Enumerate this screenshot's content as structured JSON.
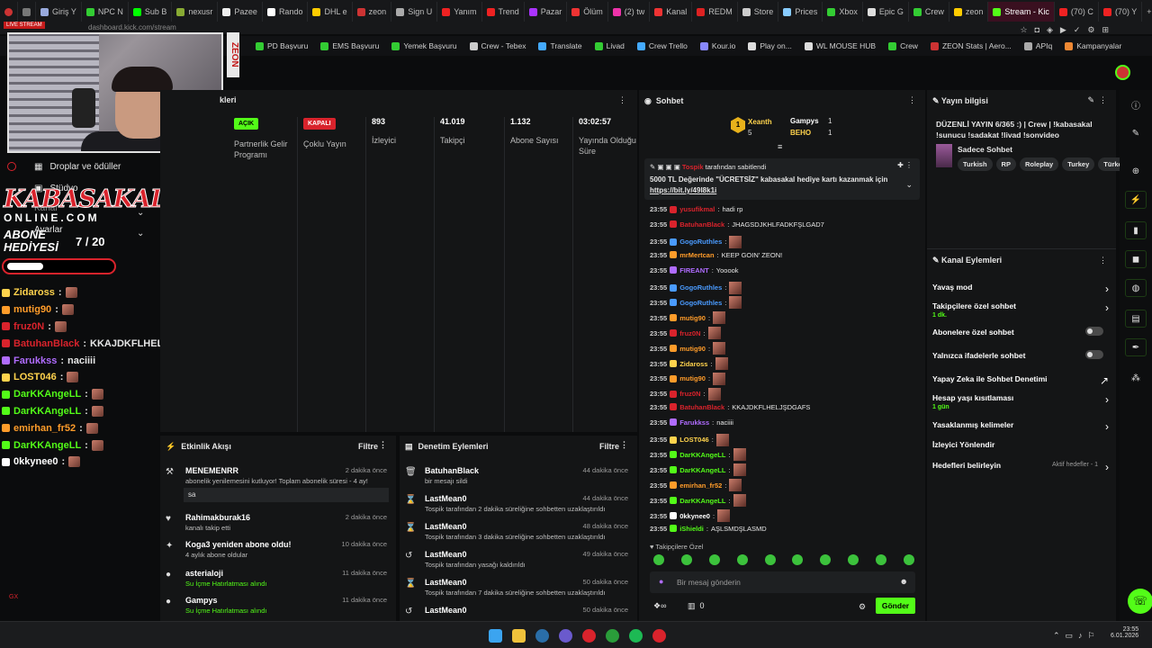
{
  "colors": {
    "accent": "#53fc18",
    "danger": "#d9232c",
    "panel": "#141516"
  },
  "browser": {
    "tabs": [
      {
        "label": "Giriş Y",
        "fav": "#9ad"
      },
      {
        "label": "NPC N",
        "fav": "#3c3"
      },
      {
        "label": "Sub B",
        "fav": "#0f0"
      },
      {
        "label": "nexusr",
        "fav": "#8a3"
      },
      {
        "label": "Pazee",
        "fav": "#eee"
      },
      {
        "label": "Rando",
        "fav": "#fff"
      },
      {
        "label": "DHL e",
        "fav": "#fc0"
      },
      {
        "label": "zeon",
        "fav": "#c33"
      },
      {
        "label": "Sign U",
        "fav": "#aaa"
      },
      {
        "label": "Yanım",
        "fav": "#e22"
      },
      {
        "label": "Trend",
        "fav": "#e22"
      },
      {
        "label": "Pazar",
        "fav": "#a3f"
      },
      {
        "label": "Ölüm",
        "fav": "#e33"
      },
      {
        "label": "(2) tw",
        "fav": "#e3a"
      },
      {
        "label": "Kanal",
        "fav": "#e33"
      },
      {
        "label": "REDM",
        "fav": "#d22"
      },
      {
        "label": "Store",
        "fav": "#ccc"
      },
      {
        "label": "Prices",
        "fav": "#8cf"
      },
      {
        "label": "Xbox",
        "fav": "#3c3"
      },
      {
        "label": "Epic G",
        "fav": "#ddd"
      },
      {
        "label": "Crew",
        "fav": "#3c3"
      },
      {
        "label": "zeon",
        "fav": "#fc0"
      },
      {
        "label": "Stream - Kic",
        "fav": "#53fc18",
        "active": true
      },
      {
        "label": "(70) C",
        "fav": "#e22"
      },
      {
        "label": "(70) Y",
        "fav": "#e22"
      }
    ],
    "address": "dashboard.kick.com/stream",
    "bookmarks": [
      {
        "label": "PD Başvuru",
        "color": "#3c3"
      },
      {
        "label": "EMS Başvuru",
        "color": "#3c3"
      },
      {
        "label": "Yemek Başvuru",
        "color": "#3c3"
      },
      {
        "label": "Crew - Tebex",
        "color": "#ccc"
      },
      {
        "label": "Translate",
        "color": "#4af"
      },
      {
        "label": "Livad",
        "color": "#3c3"
      },
      {
        "label": "Crew Trello",
        "color": "#4af"
      },
      {
        "label": "Kour.io",
        "color": "#88f"
      },
      {
        "label": "Play on...",
        "color": "#ddd"
      },
      {
        "label": "WL MOUSE HUB",
        "color": "#ddd"
      },
      {
        "label": "Crew",
        "color": "#3c3"
      },
      {
        "label": "ZEON Stats | Aero...",
        "color": "#c33"
      },
      {
        "label": "APIq",
        "color": "#aaa"
      },
      {
        "label": "Kampanyalar",
        "color": "#e83"
      }
    ]
  },
  "webcam": {
    "live_badge": "LIVE STREAM",
    "side_banner": "ZEON"
  },
  "left_menu": {
    "drops": "Droplar ve ödüller",
    "studio": "Stüdyo",
    "kanal": "Kanal",
    "settings": "Ayarlar"
  },
  "overlay": {
    "brand_line1": "KABASAKAL",
    "brand_line2": "ONLINE.COM",
    "sub_goal_line1": "ABONE",
    "sub_goal_line2": "HEDİYESİ",
    "sub_goal_count": "7 / 20",
    "sub_goal_progress": 0.35,
    "chat": [
      {
        "user": "Zidaross",
        "color": "#ffd34d",
        "msg": "",
        "emote": true
      },
      {
        "user": "mutig90",
        "color": "#ff9c2a",
        "msg": "",
        "emote": true
      },
      {
        "user": "fruz0N",
        "color": "#d9232c",
        "msg": "",
        "emote": true
      },
      {
        "user": "BatuhanBlack",
        "color": "#d9232c",
        "msg": "KKAJDKFLHELJŞDGAFS",
        "emote": false
      },
      {
        "user": "Farukkss",
        "color": "#b06cff",
        "msg": "naciiii",
        "emote": false
      },
      {
        "user": "LOST046",
        "color": "#ffd34d",
        "msg": "",
        "emote": true
      },
      {
        "user": "DarKKAngeLL",
        "color": "#53fc18",
        "msg": "",
        "emote": true
      },
      {
        "user": "DarKKAngeLL",
        "color": "#53fc18",
        "msg": "",
        "emote": true
      },
      {
        "user": "emirhan_fr52",
        "color": "#ff9c2a",
        "msg": "",
        "emote": true
      },
      {
        "user": "DarKKAngeLL",
        "color": "#53fc18",
        "msg": "",
        "emote": true
      },
      {
        "user": "0kkynee0",
        "color": "#ffffff",
        "msg": "",
        "emote": true
      }
    ]
  },
  "main": {
    "header": "kleri",
    "stats": [
      {
        "pill": "AÇIK",
        "pill_color": "#53fc18",
        "label": "Partnerlik Gelir Programı"
      },
      {
        "pill": "KAPALI",
        "pill_color": "#d9232c",
        "label": "Çoklu Yayın"
      },
      {
        "value": "893",
        "label": "İzleyici"
      },
      {
        "value": "41.019",
        "label": "Takipçi"
      },
      {
        "value": "1.132",
        "label": "Abone Sayısı"
      },
      {
        "value": "03:02:57",
        "label": "Yayında Olduğu Süre"
      }
    ]
  },
  "activity": {
    "title": "Etkinlik Akışı",
    "filter": "Filtre",
    "items": [
      {
        "icon": "⚒",
        "name": "MENEMENRR",
        "time": "2 dakika önce",
        "sub": "abonelik yenilemesini kutluyor! Toplam abonelik süresi - 4 ay!",
        "quote": "sa"
      },
      {
        "icon": "♥",
        "name": "Rahimakburak16",
        "time": "2 dakika önce",
        "sub": "kanalı takip etti"
      },
      {
        "icon": "✦",
        "name": "Koga3 yeniden abone oldu!",
        "time": "10 dakika önce",
        "sub": "4 aylık abone oldular"
      },
      {
        "icon": "●",
        "name": "asterialoji",
        "time": "11 dakika önce",
        "sub": "Su İçme Hatırlatması alındı",
        "hl": "Su İçme Hatırlatması"
      },
      {
        "icon": "●",
        "name": "Gampys",
        "time": "11 dakika önce",
        "sub": "Su İçme Hatırlatması alındı",
        "hl": "Su İçme Hatırlatması"
      }
    ]
  },
  "moderation": {
    "title": "Denetim Eylemleri",
    "filter": "Filtre",
    "items": [
      {
        "icon": "🗑",
        "name": "BatuhanBlack",
        "time": "44 dakika önce",
        "sub": "bir mesajı sildi"
      },
      {
        "icon": "⌛",
        "name": "LastMean0",
        "time": "44 dakika önce",
        "sub": "Tospik tarafından 2 dakika süreliğine sohbetten uzaklaştırıldı"
      },
      {
        "icon": "⌛",
        "name": "LastMean0",
        "time": "48 dakika önce",
        "sub": "Tospik tarafından 3 dakika süreliğine sohbetten uzaklaştırıldı"
      },
      {
        "icon": "↺",
        "name": "LastMean0",
        "time": "49 dakika önce",
        "sub": "Tospik tarafından yasağı kaldırıldı"
      },
      {
        "icon": "⌛",
        "name": "LastMean0",
        "time": "50 dakika önce",
        "sub": "Tospik tarafından 7 dakika süreliğine sohbetten uzaklaştırıldı"
      },
      {
        "icon": "↺",
        "name": "LastMean0",
        "time": "50 dakika önce",
        "sub": ""
      }
    ]
  },
  "chat": {
    "title": "Sohbet",
    "top_gifters": [
      {
        "name": "Xeanth",
        "count": "5",
        "rank": "1"
      },
      {
        "name": "Gampys",
        "count": "1"
      },
      {
        "name": "BEHO",
        "count": "1"
      }
    ],
    "pinned_by": "Tospik",
    "pinned_label": "tarafından sabitlendi",
    "pinned_text": "5000 TL Değerinde \"ÜCRETSİZ\" kabasakal hediye kartı kazanmak için",
    "pinned_link": "https://bit.ly/49I8k1i",
    "messages": [
      {
        "t": "23:55",
        "u": "yusufikmal",
        "c": "#d9232c",
        "m": "hadi rp"
      },
      {
        "t": "23:55",
        "u": "BatuhanBlack",
        "c": "#d9232c",
        "m": "JHAGSDJKHLFADKFŞLGAD7"
      },
      {
        "t": "23:55",
        "u": "GogoRuthles",
        "c": "#4a9bff",
        "m": "",
        "e": true
      },
      {
        "t": "23:55",
        "u": "mrMertcan",
        "c": "#ff9c2a",
        "m": "KEEP GOIN' ZEON!"
      },
      {
        "t": "23:55",
        "u": "FIREANT",
        "c": "#b06cff",
        "m": "Yooook"
      },
      {
        "t": "23:55",
        "u": "GogoRuthles",
        "c": "#4a9bff",
        "m": "",
        "e": true
      },
      {
        "t": "23:55",
        "u": "GogoRuthles",
        "c": "#4a9bff",
        "m": "",
        "e": true
      },
      {
        "t": "23:55",
        "u": "mutig90",
        "c": "#ff9c2a",
        "m": "",
        "e": true
      },
      {
        "t": "23:55",
        "u": "fruz0N",
        "c": "#d9232c",
        "m": "",
        "e": true
      },
      {
        "t": "23:55",
        "u": "mutig90",
        "c": "#ff9c2a",
        "m": "",
        "e": true
      },
      {
        "t": "23:55",
        "u": "Zidaross",
        "c": "#ffd34d",
        "m": "",
        "e": true
      },
      {
        "t": "23:55",
        "u": "mutig90",
        "c": "#ff9c2a",
        "m": "",
        "e": true
      },
      {
        "t": "23:55",
        "u": "fruz0N",
        "c": "#d9232c",
        "m": "",
        "e": true
      },
      {
        "t": "23:55",
        "u": "BatuhanBlack",
        "c": "#d9232c",
        "m": "KKAJDKFLHELJŞDGAFS"
      },
      {
        "t": "23:55",
        "u": "Farukkss",
        "c": "#b06cff",
        "m": "naciiii"
      },
      {
        "t": "23:55",
        "u": "LOST046",
        "c": "#ffd34d",
        "m": "",
        "e": true
      },
      {
        "t": "23:55",
        "u": "DarKKAngeLL",
        "c": "#53fc18",
        "m": "",
        "e": true
      },
      {
        "t": "23:55",
        "u": "DarKKAngeLL",
        "c": "#53fc18",
        "m": "",
        "e": true
      },
      {
        "t": "23:55",
        "u": "emirhan_fr52",
        "c": "#ff9c2a",
        "m": "",
        "e": true
      },
      {
        "t": "23:55",
        "u": "DarKKAngeLL",
        "c": "#53fc18",
        "m": "",
        "e": true
      },
      {
        "t": "23:55",
        "u": "0kkynee0",
        "c": "#ffffff",
        "m": "",
        "e": true
      },
      {
        "t": "23:55",
        "u": "iShieldi",
        "c": "#53fc18",
        "m": "AŞLSMDŞLASMD"
      }
    ],
    "followers_only": "Takipçilere Özel",
    "input_placeholder": "Bir mesaj gönderin",
    "count": "0",
    "send": "Gönder"
  },
  "stream_info": {
    "title": "Yayın bilgisi",
    "text": "DÜZENLİ YAYIN 6/365 :) | Crew | !kabasakal !sunucu !sadakat !livad !sonvideo",
    "category": "Sadece Sohbet",
    "tags": [
      "Turkish",
      "RP",
      "Roleplay",
      "Turkey",
      "Türkçe"
    ]
  },
  "channel_actions": {
    "title": "Kanal Eylemleri",
    "rows": [
      {
        "label": "Yavaş mod",
        "type": "chev"
      },
      {
        "label": "Takipçilere özel sohbet",
        "sub": "1 dk.",
        "type": "chev"
      },
      {
        "label": "Abonelere özel sohbet",
        "type": "toggle"
      },
      {
        "label": "Yalnızca ifadelerle sohbet",
        "type": "toggle"
      },
      {
        "label": "Yapay Zeka ile Sohbet Denetimi",
        "type": "ext"
      },
      {
        "label": "Hesap yaşı kısıtlaması",
        "sub": "1 gün",
        "type": "chev"
      },
      {
        "label": "Yasaklanmış kelimeler",
        "type": "chev"
      },
      {
        "label": "İzleyici Yönlendir",
        "type": "none"
      },
      {
        "label": "Hedefleri belirleyin",
        "right": "Aktif hedefler - 1",
        "type": "chev"
      }
    ]
  },
  "taskbar": {
    "time": "23:55",
    "date": "6.01.2026"
  }
}
